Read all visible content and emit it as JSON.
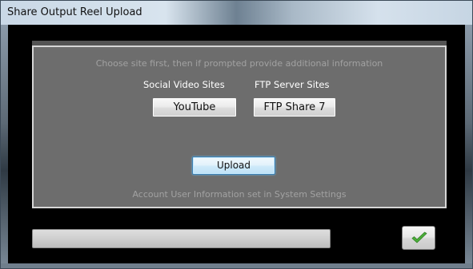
{
  "window": {
    "title": "Share Output Reel Upload"
  },
  "panel": {
    "instruction": "Choose site first, then if prompted provide additional information",
    "social_label": "Social Video Sites",
    "ftp_label": "FTP Server Sites",
    "youtube_button": "YouTube",
    "ftp_button": "FTP Share 7",
    "upload_button": "Upload",
    "account_info": "Account User Information set in System Settings"
  },
  "progress": {
    "value": 0
  },
  "ok_button": {
    "icon": "checkmark-icon"
  },
  "colors": {
    "panel_bg": "#6d6d6d",
    "dim_text": "#a2a2a2",
    "check_green": "#4caf3a"
  }
}
